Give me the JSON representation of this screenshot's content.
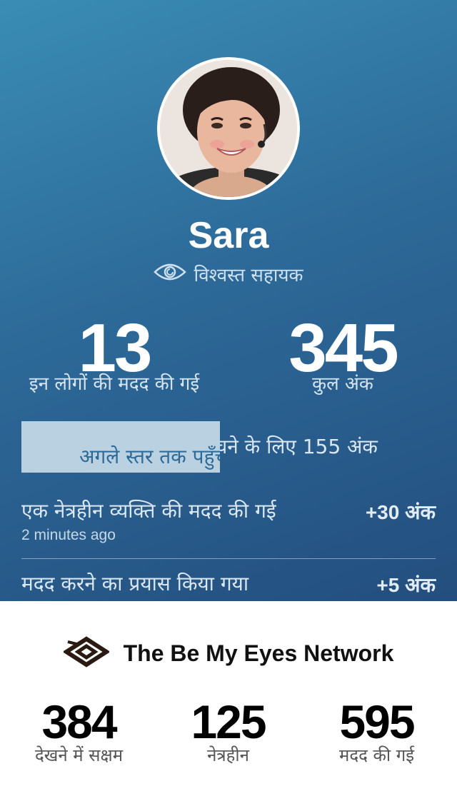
{
  "profile": {
    "name": "Sara",
    "role": "विश्वस्त सहायक",
    "role_icon": "eye-icon"
  },
  "stats": {
    "helped_count": "13",
    "helped_label": "इन लोगों की मदद की गई",
    "points_count": "345",
    "points_label": "कुल अंक"
  },
  "level": {
    "text": "अगले स्तर तक पहुँचने के लिए 155 अंक",
    "progress_fraction": 0.48
  },
  "activities": [
    {
      "title": "एक नेत्रहीन व्यक्ति की मदद की गई",
      "points": "+30 अंक",
      "time": "2 minutes ago"
    },
    {
      "title": "मदद करने का प्रयास किया गया",
      "points": "+5 अंक"
    }
  ],
  "network": {
    "logo_icon": "be-my-eyes-logo-icon",
    "title": "The Be My Eyes Network",
    "stats": [
      {
        "value": "384",
        "label": "देखने में सक्षम"
      },
      {
        "value": "125",
        "label": "नेत्रहीन"
      },
      {
        "value": "595",
        "label": "मदद की गई"
      }
    ]
  },
  "colors": {
    "gradient_start": "#3a8db5",
    "gradient_end": "#234e7e",
    "progress_fill": "#b9d1e1"
  }
}
